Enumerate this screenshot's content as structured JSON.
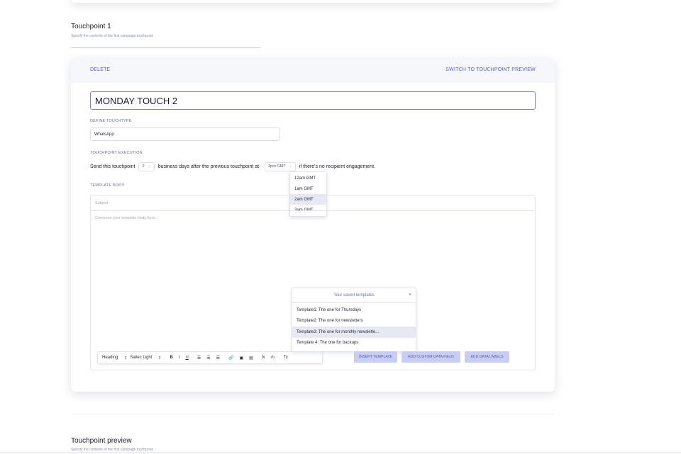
{
  "section1": {
    "title": "Touchpoint 1",
    "subtitle": "Specify the contents of the first campaign touchpoint"
  },
  "card": {
    "delete_label": "DELETE",
    "switch_label": "SWITCH TO TOUCHPOINT PREVIEW",
    "touchpoint_name": "MONDAY TOUCH 2",
    "touchtype_label": "DEFINE TOUCHTYPE",
    "touchtype_value": "WhatsApp",
    "execution_label": "TOUCHPOINT EXECUTION",
    "execution": {
      "text_before": "Send this touchpoint",
      "days_value": "2",
      "text_middle": "business days after the previous touchpoint at",
      "time_value": "2pm GMT",
      "text_after": "if there's no recipient engagement."
    },
    "time_options": [
      "12am GMT",
      "1am GMT",
      "2am GMT",
      "3am GMT"
    ],
    "time_selected_index": 2,
    "template_body_label": "TEMPLATE BODY",
    "subject_placeholder": "Subject",
    "body_placeholder": "Compose your template body here...",
    "saved_templates": {
      "title": "Your saved templates",
      "close": "×",
      "items": [
        "Template1: The one for Thursdays",
        "Template2: The one for newsletters",
        "Template3: The one for monthly newslette...",
        "Template 4: The one for backups"
      ],
      "selected_index": 2
    },
    "toolbar": {
      "heading": "Heading",
      "font": "Sailec Light",
      "bold": "B",
      "italic": "I",
      "underline": "U",
      "list_ordered": "☰",
      "list_bulleted": "☰",
      "align": "☰",
      "link": "🔗",
      "image": "▣",
      "video": "▤",
      "formula": "fx",
      "code": "‹/›",
      "clear_format": "Tx"
    },
    "buttons": {
      "insert_template": "INSERT TEMPLATE",
      "add_custom_data_field": "ADD CUSTOM DATA FIELD",
      "add_data_labels": "ADD DATA LABELS"
    }
  },
  "section2": {
    "title": "Touchpoint preview",
    "subtitle": "Specify the contents of the first campaign touchpoint"
  },
  "colors": {
    "accent": "#4f5bd5",
    "button_bg": "#c9cdf2",
    "selected_bg": "#e6e8f3"
  }
}
